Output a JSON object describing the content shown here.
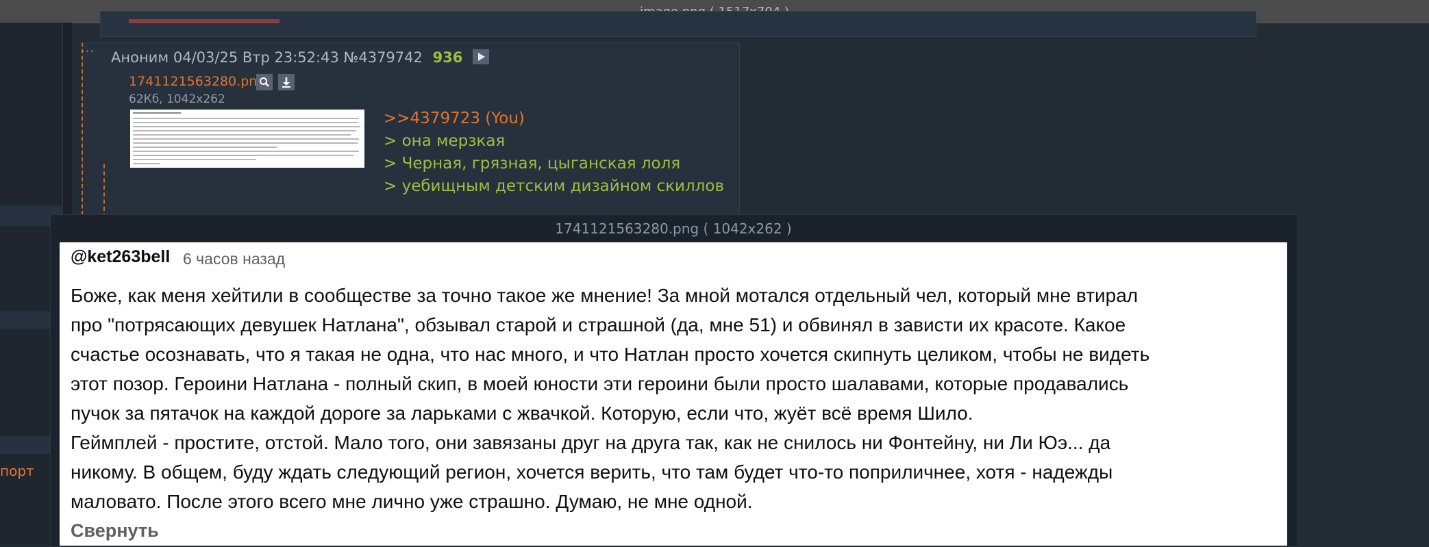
{
  "window": {
    "title": "image.png ( 1517x704 )"
  },
  "sidebar": {
    "report_link": "порт"
  },
  "post": {
    "author": "Аноним",
    "datetime": "04/03/25 Втр 23:52:43",
    "post_number": "№4379742",
    "reply_count": "936",
    "file": {
      "name": "1741121563280.png",
      "size_info": "62Кб, 1042x262"
    },
    "reply_ref": ">>4379723 (You)",
    "greentext": [
      "> она мерзкая",
      "> Черная, грязная, цыганская лоля",
      "> уебищным детским дизайном скиллов"
    ]
  },
  "viewer": {
    "title": "1741121563280.png ( 1042x262 )",
    "comment": {
      "username": "@ket263bell",
      "time_ago": "6 часов назад",
      "lines": [
        "Боже, как меня хейтили в сообществе за точно такое же мнение! За мной мотался отдельный чел, который мне втирал",
        "про \"потрясающих девушек Натлана\", обзывал старой и страшной (да, мне 51) и обвинял в зависти их красоте. Какое",
        "счастье осознавать, что я такая не одна, что нас много, и что Натлан просто хочется скипнуть целиком, чтобы не видеть",
        "этот позор. Героини Натлана - полный скип, в моей юности эти героини были просто шалавами, которые продавались",
        "пучок за пятачок на каждой дороге за ларьками с жвачкой. Которую, если что, жуёт всё время Шило.",
        "Геймплей - простите, отстой. Мало того, они завязаны друг на друга так, как не снилось ни Фонтейну, ни Ли Юэ... да",
        "никому. В общем, буду ждать следующий регион, хочется верить, что там будет что-то поприличнее, хотя - надежды",
        "маловато. После этого всего мне лично уже страшно. Думаю, не мне одной."
      ],
      "collapse_label": "Свернуть"
    }
  },
  "icons": {
    "play": "play-icon",
    "search": "search-icon",
    "download": "download-icon"
  },
  "colors": {
    "accent_orange": "#e0762d",
    "greentext": "#9fbd3f",
    "background": "#232b35"
  }
}
